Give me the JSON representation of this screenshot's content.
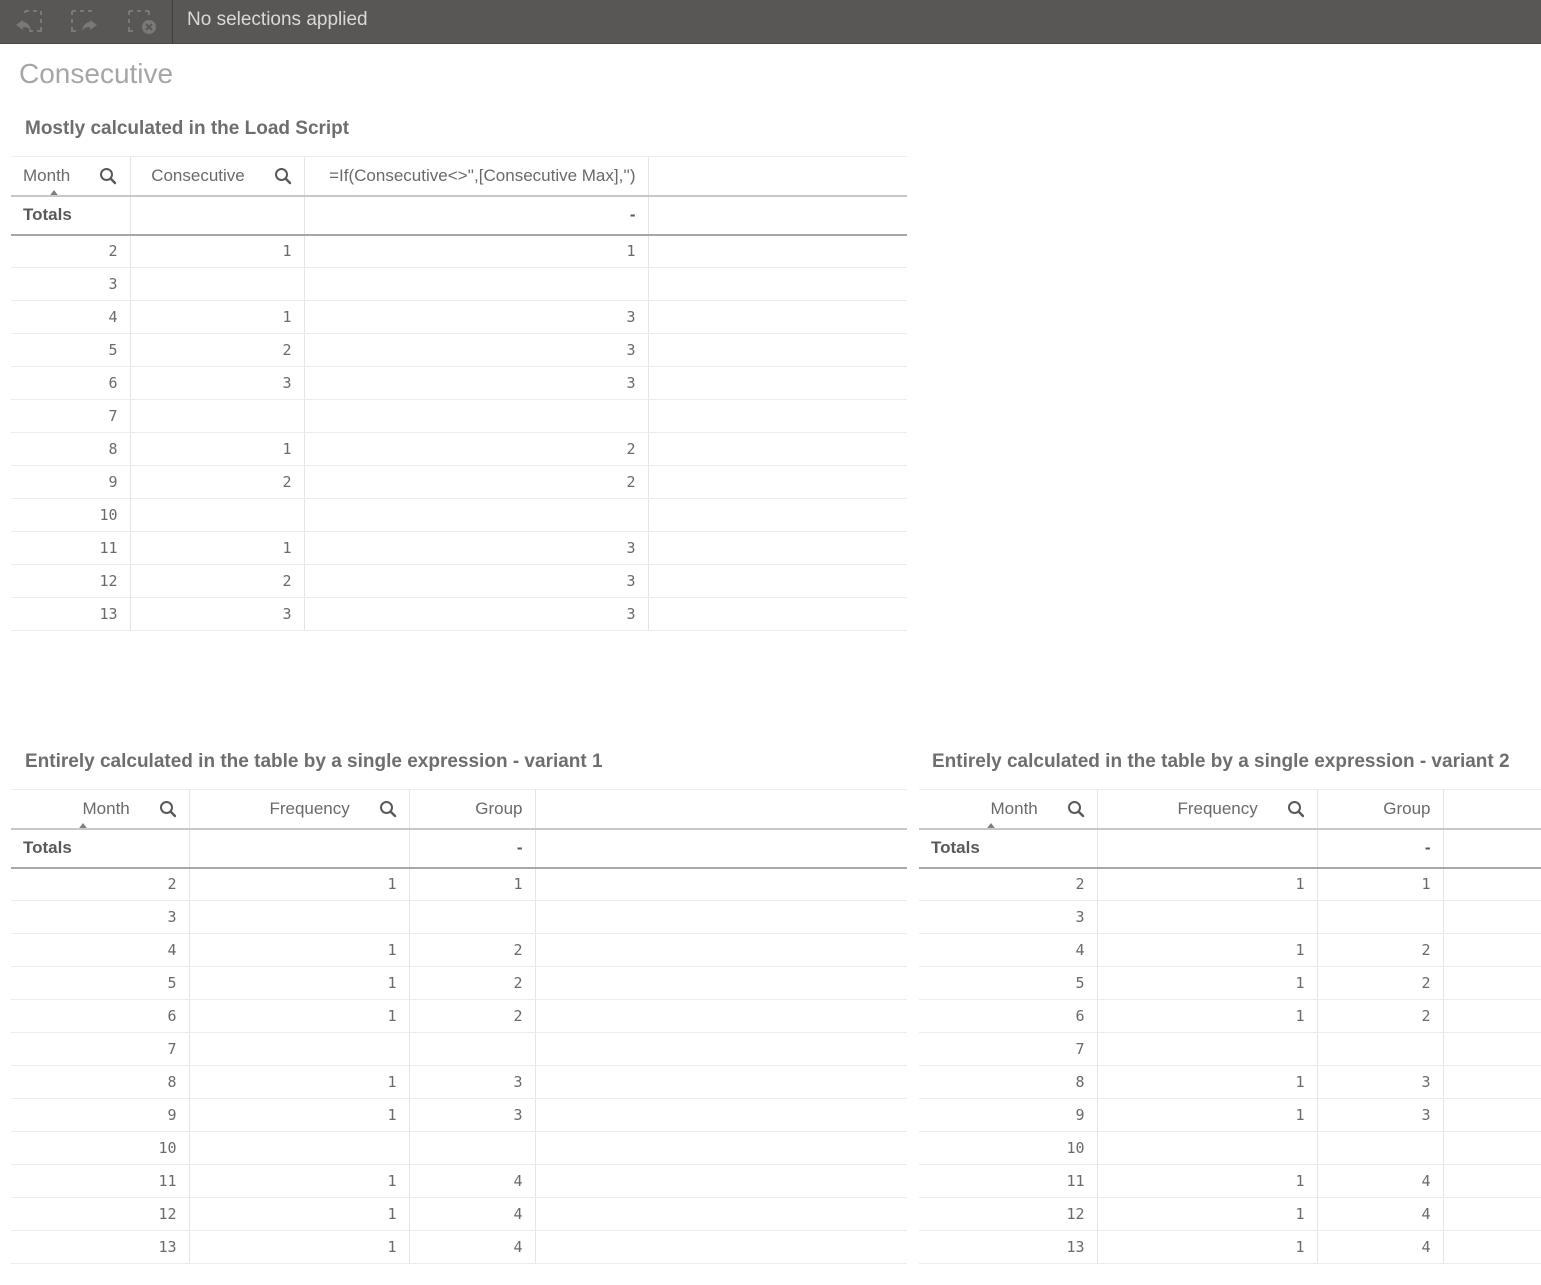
{
  "toolbar": {
    "icons": [
      "step-back-icon",
      "step-forward-icon",
      "clear-selections-icon"
    ],
    "status": "No selections applied",
    "bg_color": "#585756"
  },
  "sheet": {
    "title": "Consecutive"
  },
  "table1": {
    "title": "Mostly calculated in the Load Script",
    "headers": [
      "Month",
      "Consecutive",
      "=If(Consecutive<>'',[Consecutive Max],'')"
    ],
    "totals_label": "Totals",
    "totals": [
      "",
      "",
      "-"
    ],
    "sorted_column": "Month",
    "rows": [
      [
        "2",
        "1",
        "1"
      ],
      [
        "3",
        "",
        ""
      ],
      [
        "4",
        "1",
        "3"
      ],
      [
        "5",
        "2",
        "3"
      ],
      [
        "6",
        "3",
        "3"
      ],
      [
        "7",
        "",
        ""
      ],
      [
        "8",
        "1",
        "2"
      ],
      [
        "9",
        "2",
        "2"
      ],
      [
        "10",
        "",
        ""
      ],
      [
        "11",
        "1",
        "3"
      ],
      [
        "12",
        "2",
        "3"
      ],
      [
        "13",
        "3",
        "3"
      ]
    ]
  },
  "table2": {
    "title": "Entirely calculated in the table by a single expression - variant 1",
    "headers": [
      "Month",
      "Frequency",
      "Group"
    ],
    "totals_label": "Totals",
    "totals": [
      "",
      "",
      "-"
    ],
    "sorted_column": "Month",
    "rows": [
      [
        "2",
        "1",
        "1"
      ],
      [
        "3",
        "",
        ""
      ],
      [
        "4",
        "1",
        "2"
      ],
      [
        "5",
        "1",
        "2"
      ],
      [
        "6",
        "1",
        "2"
      ],
      [
        "7",
        "",
        ""
      ],
      [
        "8",
        "1",
        "3"
      ],
      [
        "9",
        "1",
        "3"
      ],
      [
        "10",
        "",
        ""
      ],
      [
        "11",
        "1",
        "4"
      ],
      [
        "12",
        "1",
        "4"
      ],
      [
        "13",
        "1",
        "4"
      ]
    ]
  },
  "table3": {
    "title": "Entirely calculated in the table by a single expression - variant 2",
    "headers": [
      "Month",
      "Frequency",
      "Group"
    ],
    "totals_label": "Totals",
    "totals": [
      "",
      "",
      "-"
    ],
    "sorted_column": "Month",
    "rows": [
      [
        "2",
        "1",
        "1"
      ],
      [
        "3",
        "",
        ""
      ],
      [
        "4",
        "1",
        "2"
      ],
      [
        "5",
        "1",
        "2"
      ],
      [
        "6",
        "1",
        "2"
      ],
      [
        "7",
        "",
        ""
      ],
      [
        "8",
        "1",
        "3"
      ],
      [
        "9",
        "1",
        "3"
      ],
      [
        "10",
        "",
        ""
      ],
      [
        "11",
        "1",
        "4"
      ],
      [
        "12",
        "1",
        "4"
      ],
      [
        "13",
        "1",
        "4"
      ]
    ]
  }
}
